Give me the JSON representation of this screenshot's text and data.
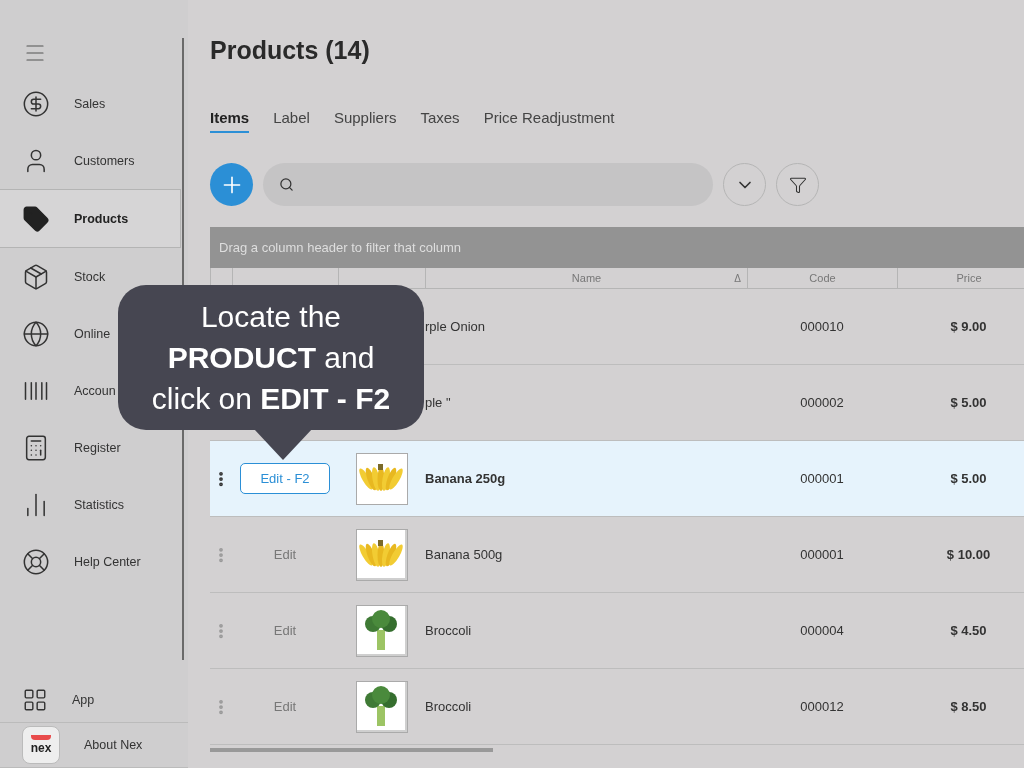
{
  "sidebar": {
    "items": [
      {
        "label": "Sales",
        "selected": false
      },
      {
        "label": "Customers",
        "selected": false
      },
      {
        "label": "Products",
        "selected": true
      },
      {
        "label": "Stock",
        "selected": false
      },
      {
        "label": "Online",
        "selected": false
      },
      {
        "label": "Accoun",
        "selected": false
      },
      {
        "label": "Register",
        "selected": false
      },
      {
        "label": "Statistics",
        "selected": false
      },
      {
        "label": "Help Center",
        "selected": false
      }
    ],
    "bottom": [
      {
        "label": "App"
      },
      {
        "label": "About Nex",
        "logo": "nex"
      }
    ]
  },
  "title": "Products (14)",
  "tabs": [
    {
      "label": "Items",
      "selected": true
    },
    {
      "label": "Label",
      "selected": false
    },
    {
      "label": "Suppliers",
      "selected": false
    },
    {
      "label": "Taxes",
      "selected": false
    },
    {
      "label": "Price Readjustment",
      "selected": false
    }
  ],
  "table": {
    "group_hint": "Drag a column header to filter that column",
    "columns": [
      {},
      {},
      {
        "label": "Name",
        "sort_mark": "Δ"
      },
      {
        "label": "Code"
      },
      {
        "label": "Price"
      }
    ],
    "rows": [
      {
        "name": "rple Onion",
        "code": "000010",
        "price": "$ 9.00",
        "selected": false
      },
      {
        "name": "ple \"",
        "code": "000002",
        "price": "$ 5.00",
        "selected": false
      },
      {
        "edit": "Edit - F2",
        "name": "Banana 250g",
        "code": "000001",
        "price": "$ 5.00",
        "selected": true,
        "kind": "banana"
      },
      {
        "edit": "Edit",
        "name": "Banana 500g",
        "code": "000001",
        "price": "$ 10.00",
        "selected": false,
        "kind": "banana"
      },
      {
        "edit": "Edit",
        "name": "Broccoli",
        "code": "000004",
        "price": "$ 4.50",
        "selected": false,
        "kind": "broccoli"
      },
      {
        "edit": "Edit",
        "name": "Broccoli",
        "code": "000012",
        "price": "$ 8.50",
        "selected": false,
        "kind": "broccoli"
      }
    ]
  },
  "callout": {
    "lines": [
      "Locate the",
      "**PRODUCT** and",
      "click on **EDIT - F2**"
    ]
  }
}
